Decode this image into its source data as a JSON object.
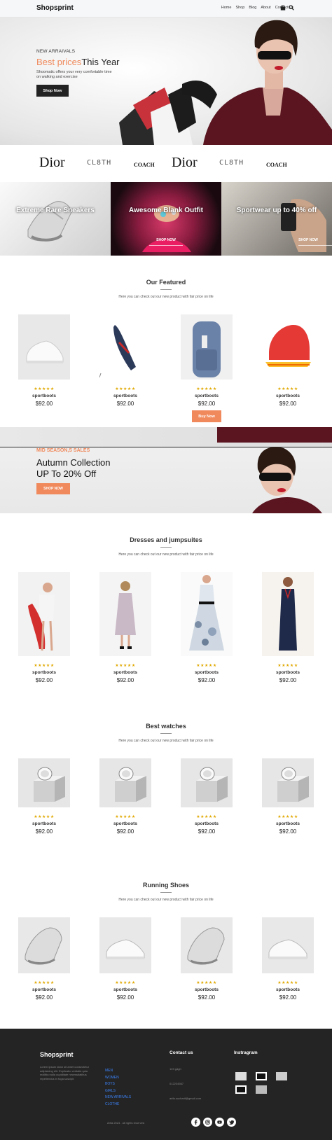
{
  "header": {
    "brand": "Shopsprint",
    "nav": [
      "Home",
      "Shop",
      "Blog",
      "About",
      "Contact us"
    ]
  },
  "hero": {
    "subtitle": "NEW ARRAIVALS",
    "title_accent": "Best prices",
    "title_rest": "This Year",
    "description": "Shoomatic offers your very comfortable time on walking and exercise",
    "button": "Shop Now"
  },
  "brands": [
    "Dior",
    "CL8TH",
    "COACH",
    "Dior",
    "CL8TH",
    "COACH"
  ],
  "categories": [
    {
      "title": "Extreme Rare Sneakers",
      "link": ""
    },
    {
      "title": "Awesome Blank Outfit",
      "link": "SHOP NOW"
    },
    {
      "title": "Sportwear up to 40% off",
      "link": "SHOP NOW"
    }
  ],
  "featured": {
    "title": "Our Featured",
    "subtitle": "Here you can check out our new product with fair price on life",
    "buy_label": "Buy Now",
    "products": [
      {
        "stars": "★★★★★",
        "name": "sportboots",
        "price": "$92.00"
      },
      {
        "stars": "★★★★★",
        "name": "sportboots",
        "price": "$92.00"
      },
      {
        "stars": "★★★★★",
        "name": "sportboots",
        "price": "$92.00"
      },
      {
        "stars": "★★★★★",
        "name": "sportboots",
        "price": "$92.00"
      }
    ]
  },
  "sale": {
    "kicker": "MID SEASON,S SALES",
    "line1": "Autumn Collection",
    "line2": "UP To 20% Off",
    "button": "SHOP NOW"
  },
  "dresses": {
    "title": "Dresses and jumpsuites",
    "subtitle": "Here you can check out our new product with fair price on life",
    "products": [
      {
        "stars": "★★★★★",
        "name": "sportboots",
        "price": "$92.00"
      },
      {
        "stars": "★★★★★",
        "name": "sportboots",
        "price": "$92.00"
      },
      {
        "stars": "★★★★★",
        "name": "sportboots",
        "price": "$92.00"
      },
      {
        "stars": "★★★★★",
        "name": "sportboots",
        "price": "$92.00"
      }
    ]
  },
  "watches": {
    "title": "Best watches",
    "subtitle": "Here you can check out our new product with fair price on life",
    "products": [
      {
        "stars": "★★★★★",
        "name": "sportboots",
        "price": "$92.00"
      },
      {
        "stars": "★★★★★",
        "name": "sportboots",
        "price": "$92.00"
      },
      {
        "stars": "★★★★★",
        "name": "sportboots",
        "price": "$92.00"
      },
      {
        "stars": "★★★★★",
        "name": "sportboots",
        "price": "$92.00"
      }
    ]
  },
  "running": {
    "title": "Running Shoes",
    "subtitle": "Here you can check out our new product with fair price on life",
    "products": [
      {
        "stars": "★★★★★",
        "name": "sportboots",
        "price": "$92.00"
      },
      {
        "stars": "★★★★★",
        "name": "sportboots",
        "price": "$92.00"
      },
      {
        "stars": "★★★★★",
        "name": "sportboots",
        "price": "$92.00"
      },
      {
        "stars": "★★★★★",
        "name": "sportboots",
        "price": "$92.00"
      }
    ]
  },
  "footer": {
    "brand": "Shopsprint",
    "description": "Lorem ipsum dolor sit amet consectetur adipisicing elit. Explicabo veritatis quia mollitia nulla cupiditate necessitatibus repellendus in fuga suscipit.",
    "links": [
      "MEN",
      "WOMEN",
      "BOYS",
      "GIRLS",
      "NEW ARRIVALS",
      "CLOTHE"
    ],
    "contact_head": "Contact us",
    "contact": [
      "123 gdgh",
      "012234567",
      "arifa.sucharif@gmail.com"
    ],
    "instagram_head": "Instragram",
    "copyright": "Arifa 2024 . all rights reserved"
  },
  "colors": {
    "accent": "#f08a5d",
    "dark": "#222222",
    "star": "#e0a800",
    "link": "#3b82f6"
  }
}
